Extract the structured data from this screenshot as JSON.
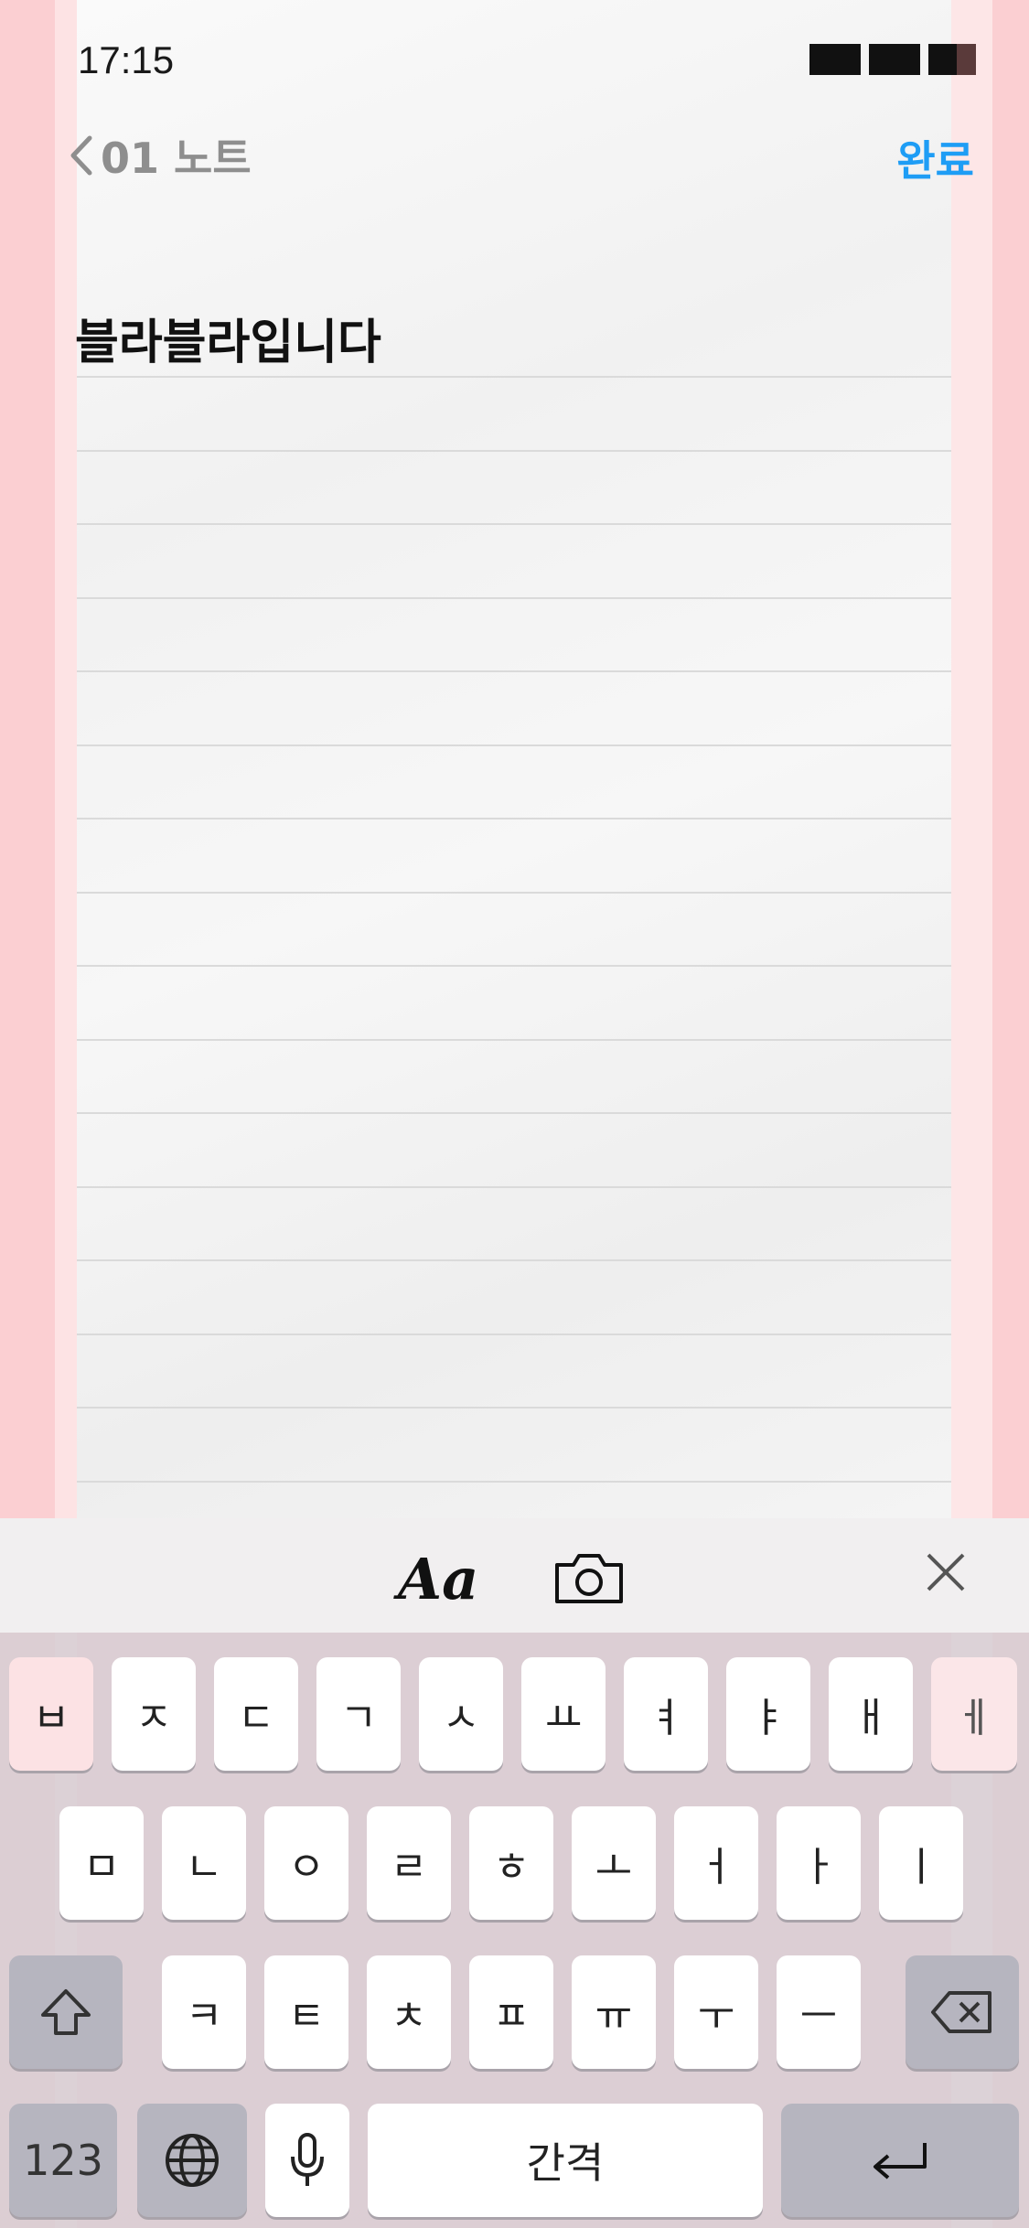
{
  "status": {
    "time": "17:15"
  },
  "nav": {
    "back_label": "01 노트",
    "done_label": "완료"
  },
  "note": {
    "text": "블라블라입니다"
  },
  "toolbar": {
    "format_label": "Aa"
  },
  "keyboard": {
    "row1": [
      "ㅂ",
      "ㅈ",
      "ㄷ",
      "ㄱ",
      "ㅅ",
      "ㅛ",
      "ㅕ",
      "ㅑ",
      "ㅐ",
      "ㅔ"
    ],
    "row2": [
      "ㅁ",
      "ㄴ",
      "ㅇ",
      "ㄹ",
      "ㅎ",
      "ㅗ",
      "ㅓ",
      "ㅏ",
      "ㅣ"
    ],
    "row3": [
      "ㅋ",
      "ㅌ",
      "ㅊ",
      "ㅍ",
      "ㅠ",
      "ㅜ",
      "ㅡ"
    ],
    "numbers_label": "123",
    "space_label": "간격"
  },
  "colors": {
    "accent": "#1e9df5",
    "stripe": "#fbcfd2",
    "paper": "#f4f4f4"
  },
  "icons": [
    "back-chevron-icon",
    "camera-icon",
    "close-icon",
    "shift-icon",
    "backspace-icon",
    "globe-icon",
    "microphone-icon",
    "return-icon"
  ]
}
